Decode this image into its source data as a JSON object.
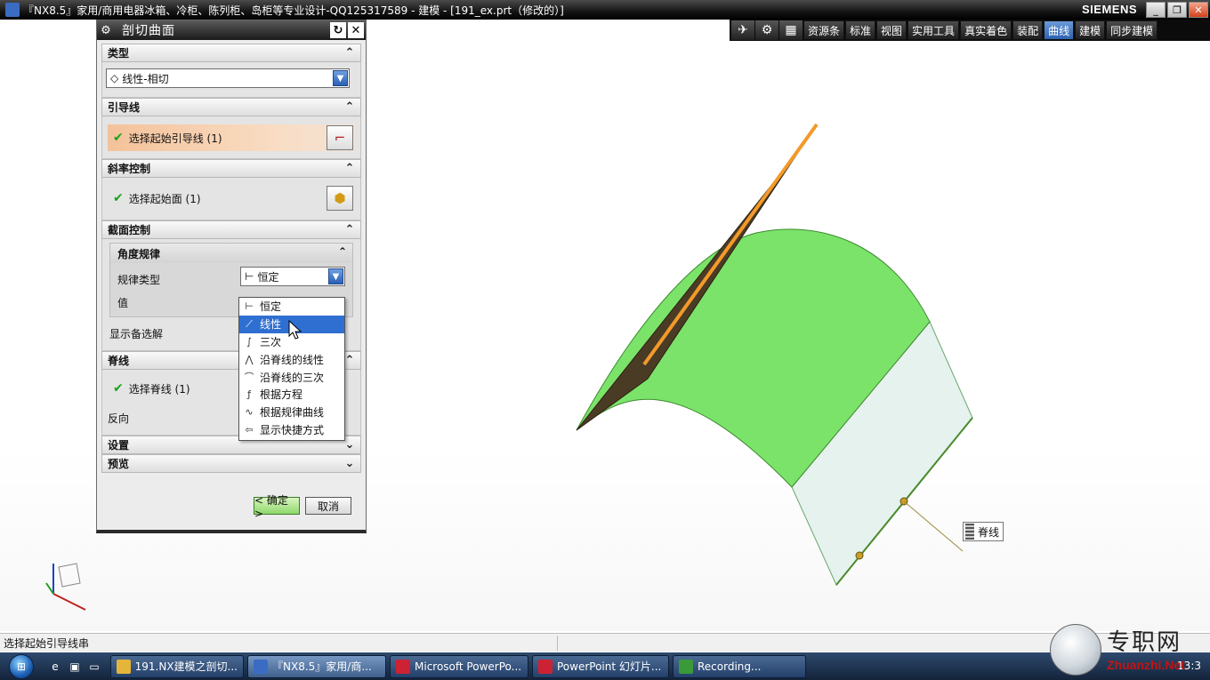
{
  "window": {
    "title": "『NX8.5』家用/商用电器冰箱、冷柜、陈列柜、岛柜等专业设计-QQ125317589 - 建模 - [191_ex.prt（修改的）]",
    "brand": "SIEMENS",
    "buttons": [
      "_",
      "❐",
      "✕"
    ]
  },
  "toolbar": {
    "tabs": [
      "资源条",
      "标准",
      "视图",
      "实用工具",
      "真实着色",
      "装配",
      "曲线",
      "建模",
      "同步建模"
    ],
    "active_tab": "曲线"
  },
  "dialog": {
    "title": "剖切曲面",
    "sections": {
      "type": {
        "label": "类型",
        "value": "线性-相切"
      },
      "guide": {
        "label": "引导线",
        "select_label": "选择起始引导线 (1)"
      },
      "slope": {
        "label": "斜率控制",
        "select_label": "选择起始面 (1)"
      },
      "section": {
        "label": "截面控制",
        "angle_law": "角度规律",
        "law_type_label": "规律类型",
        "law_type_value": "恒定",
        "value_label": "值",
        "show_alternates": "显示备选解"
      },
      "spine": {
        "label": "脊线",
        "select_label": "选择脊线 (1)",
        "reverse_label": "反向"
      },
      "settings": {
        "label": "设置"
      },
      "preview": {
        "label": "预览"
      }
    },
    "ok_label": "< 确定 >",
    "cancel_label": "取消",
    "dropdown": {
      "items": [
        "恒定",
        "线性",
        "三次",
        "沿脊线的线性",
        "沿脊线的三次",
        "根据方程",
        "根据规律曲线",
        "显示快捷方式"
      ],
      "selected": "线性"
    }
  },
  "viewport": {
    "spine_tag": "脊线",
    "axis_z": "Z",
    "axis_x": "X",
    "colors": {
      "surface": "#7be36a",
      "edge": "#f39a2a",
      "sheet": "#e6f2ee"
    }
  },
  "status": {
    "message": "选择起始引导线串"
  },
  "taskbar": {
    "tasks": [
      "191.NX建模之剖切...",
      "『NX8.5』家用/商...",
      "Microsoft PowerPo...",
      "PowerPoint 幻灯片...",
      "Recording..."
    ],
    "clock": "13:3"
  },
  "watermark": {
    "cn": "专职网",
    "en": "Zhuanzhi.Net"
  }
}
